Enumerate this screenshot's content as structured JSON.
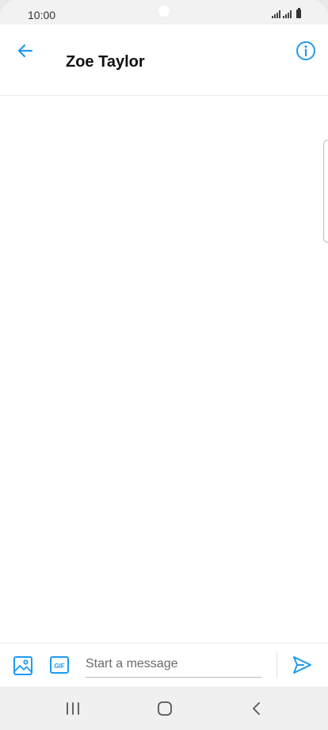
{
  "status_bar": {
    "time": "10:00"
  },
  "header": {
    "contact_name": "Zoe Taylor"
  },
  "composer": {
    "input_placeholder": "Start a message",
    "input_value": ""
  },
  "icons": {
    "back": "arrow-left-icon",
    "info": "info-icon",
    "media": "image-icon",
    "gif": "gif-icon",
    "send": "send-icon",
    "recents": "recents-icon",
    "home": "home-icon",
    "nav_back": "chevron-left-icon"
  },
  "colors": {
    "accent": "#1d9bf0",
    "status_bar_bg": "#f2f2f2",
    "nav_bar_bg": "#f0f0f0"
  }
}
